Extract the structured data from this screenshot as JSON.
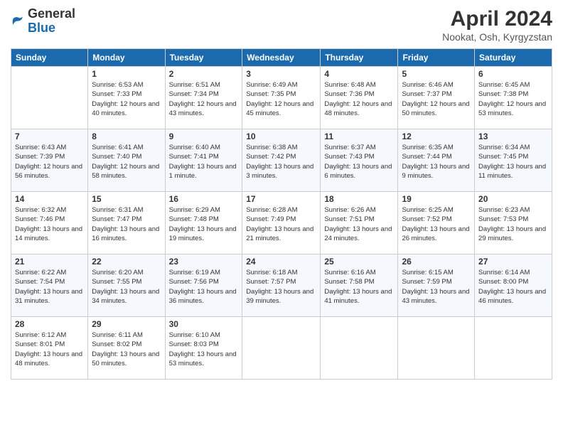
{
  "header": {
    "logo_general": "General",
    "logo_blue": "Blue",
    "month_title": "April 2024",
    "location": "Nookat, Osh, Kyrgyzstan"
  },
  "weekdays": [
    "Sunday",
    "Monday",
    "Tuesday",
    "Wednesday",
    "Thursday",
    "Friday",
    "Saturday"
  ],
  "weeks": [
    [
      {
        "day": "",
        "sunrise": "",
        "sunset": "",
        "daylight": ""
      },
      {
        "day": "1",
        "sunrise": "Sunrise: 6:53 AM",
        "sunset": "Sunset: 7:33 PM",
        "daylight": "Daylight: 12 hours and 40 minutes."
      },
      {
        "day": "2",
        "sunrise": "Sunrise: 6:51 AM",
        "sunset": "Sunset: 7:34 PM",
        "daylight": "Daylight: 12 hours and 43 minutes."
      },
      {
        "day": "3",
        "sunrise": "Sunrise: 6:49 AM",
        "sunset": "Sunset: 7:35 PM",
        "daylight": "Daylight: 12 hours and 45 minutes."
      },
      {
        "day": "4",
        "sunrise": "Sunrise: 6:48 AM",
        "sunset": "Sunset: 7:36 PM",
        "daylight": "Daylight: 12 hours and 48 minutes."
      },
      {
        "day": "5",
        "sunrise": "Sunrise: 6:46 AM",
        "sunset": "Sunset: 7:37 PM",
        "daylight": "Daylight: 12 hours and 50 minutes."
      },
      {
        "day": "6",
        "sunrise": "Sunrise: 6:45 AM",
        "sunset": "Sunset: 7:38 PM",
        "daylight": "Daylight: 12 hours and 53 minutes."
      }
    ],
    [
      {
        "day": "7",
        "sunrise": "Sunrise: 6:43 AM",
        "sunset": "Sunset: 7:39 PM",
        "daylight": "Daylight: 12 hours and 56 minutes."
      },
      {
        "day": "8",
        "sunrise": "Sunrise: 6:41 AM",
        "sunset": "Sunset: 7:40 PM",
        "daylight": "Daylight: 12 hours and 58 minutes."
      },
      {
        "day": "9",
        "sunrise": "Sunrise: 6:40 AM",
        "sunset": "Sunset: 7:41 PM",
        "daylight": "Daylight: 13 hours and 1 minute."
      },
      {
        "day": "10",
        "sunrise": "Sunrise: 6:38 AM",
        "sunset": "Sunset: 7:42 PM",
        "daylight": "Daylight: 13 hours and 3 minutes."
      },
      {
        "day": "11",
        "sunrise": "Sunrise: 6:37 AM",
        "sunset": "Sunset: 7:43 PM",
        "daylight": "Daylight: 13 hours and 6 minutes."
      },
      {
        "day": "12",
        "sunrise": "Sunrise: 6:35 AM",
        "sunset": "Sunset: 7:44 PM",
        "daylight": "Daylight: 13 hours and 9 minutes."
      },
      {
        "day": "13",
        "sunrise": "Sunrise: 6:34 AM",
        "sunset": "Sunset: 7:45 PM",
        "daylight": "Daylight: 13 hours and 11 minutes."
      }
    ],
    [
      {
        "day": "14",
        "sunrise": "Sunrise: 6:32 AM",
        "sunset": "Sunset: 7:46 PM",
        "daylight": "Daylight: 13 hours and 14 minutes."
      },
      {
        "day": "15",
        "sunrise": "Sunrise: 6:31 AM",
        "sunset": "Sunset: 7:47 PM",
        "daylight": "Daylight: 13 hours and 16 minutes."
      },
      {
        "day": "16",
        "sunrise": "Sunrise: 6:29 AM",
        "sunset": "Sunset: 7:48 PM",
        "daylight": "Daylight: 13 hours and 19 minutes."
      },
      {
        "day": "17",
        "sunrise": "Sunrise: 6:28 AM",
        "sunset": "Sunset: 7:49 PM",
        "daylight": "Daylight: 13 hours and 21 minutes."
      },
      {
        "day": "18",
        "sunrise": "Sunrise: 6:26 AM",
        "sunset": "Sunset: 7:51 PM",
        "daylight": "Daylight: 13 hours and 24 minutes."
      },
      {
        "day": "19",
        "sunrise": "Sunrise: 6:25 AM",
        "sunset": "Sunset: 7:52 PM",
        "daylight": "Daylight: 13 hours and 26 minutes."
      },
      {
        "day": "20",
        "sunrise": "Sunrise: 6:23 AM",
        "sunset": "Sunset: 7:53 PM",
        "daylight": "Daylight: 13 hours and 29 minutes."
      }
    ],
    [
      {
        "day": "21",
        "sunrise": "Sunrise: 6:22 AM",
        "sunset": "Sunset: 7:54 PM",
        "daylight": "Daylight: 13 hours and 31 minutes."
      },
      {
        "day": "22",
        "sunrise": "Sunrise: 6:20 AM",
        "sunset": "Sunset: 7:55 PM",
        "daylight": "Daylight: 13 hours and 34 minutes."
      },
      {
        "day": "23",
        "sunrise": "Sunrise: 6:19 AM",
        "sunset": "Sunset: 7:56 PM",
        "daylight": "Daylight: 13 hours and 36 minutes."
      },
      {
        "day": "24",
        "sunrise": "Sunrise: 6:18 AM",
        "sunset": "Sunset: 7:57 PM",
        "daylight": "Daylight: 13 hours and 39 minutes."
      },
      {
        "day": "25",
        "sunrise": "Sunrise: 6:16 AM",
        "sunset": "Sunset: 7:58 PM",
        "daylight": "Daylight: 13 hours and 41 minutes."
      },
      {
        "day": "26",
        "sunrise": "Sunrise: 6:15 AM",
        "sunset": "Sunset: 7:59 PM",
        "daylight": "Daylight: 13 hours and 43 minutes."
      },
      {
        "day": "27",
        "sunrise": "Sunrise: 6:14 AM",
        "sunset": "Sunset: 8:00 PM",
        "daylight": "Daylight: 13 hours and 46 minutes."
      }
    ],
    [
      {
        "day": "28",
        "sunrise": "Sunrise: 6:12 AM",
        "sunset": "Sunset: 8:01 PM",
        "daylight": "Daylight: 13 hours and 48 minutes."
      },
      {
        "day": "29",
        "sunrise": "Sunrise: 6:11 AM",
        "sunset": "Sunset: 8:02 PM",
        "daylight": "Daylight: 13 hours and 50 minutes."
      },
      {
        "day": "30",
        "sunrise": "Sunrise: 6:10 AM",
        "sunset": "Sunset: 8:03 PM",
        "daylight": "Daylight: 13 hours and 53 minutes."
      },
      {
        "day": "",
        "sunrise": "",
        "sunset": "",
        "daylight": ""
      },
      {
        "day": "",
        "sunrise": "",
        "sunset": "",
        "daylight": ""
      },
      {
        "day": "",
        "sunrise": "",
        "sunset": "",
        "daylight": ""
      },
      {
        "day": "",
        "sunrise": "",
        "sunset": "",
        "daylight": ""
      }
    ]
  ]
}
